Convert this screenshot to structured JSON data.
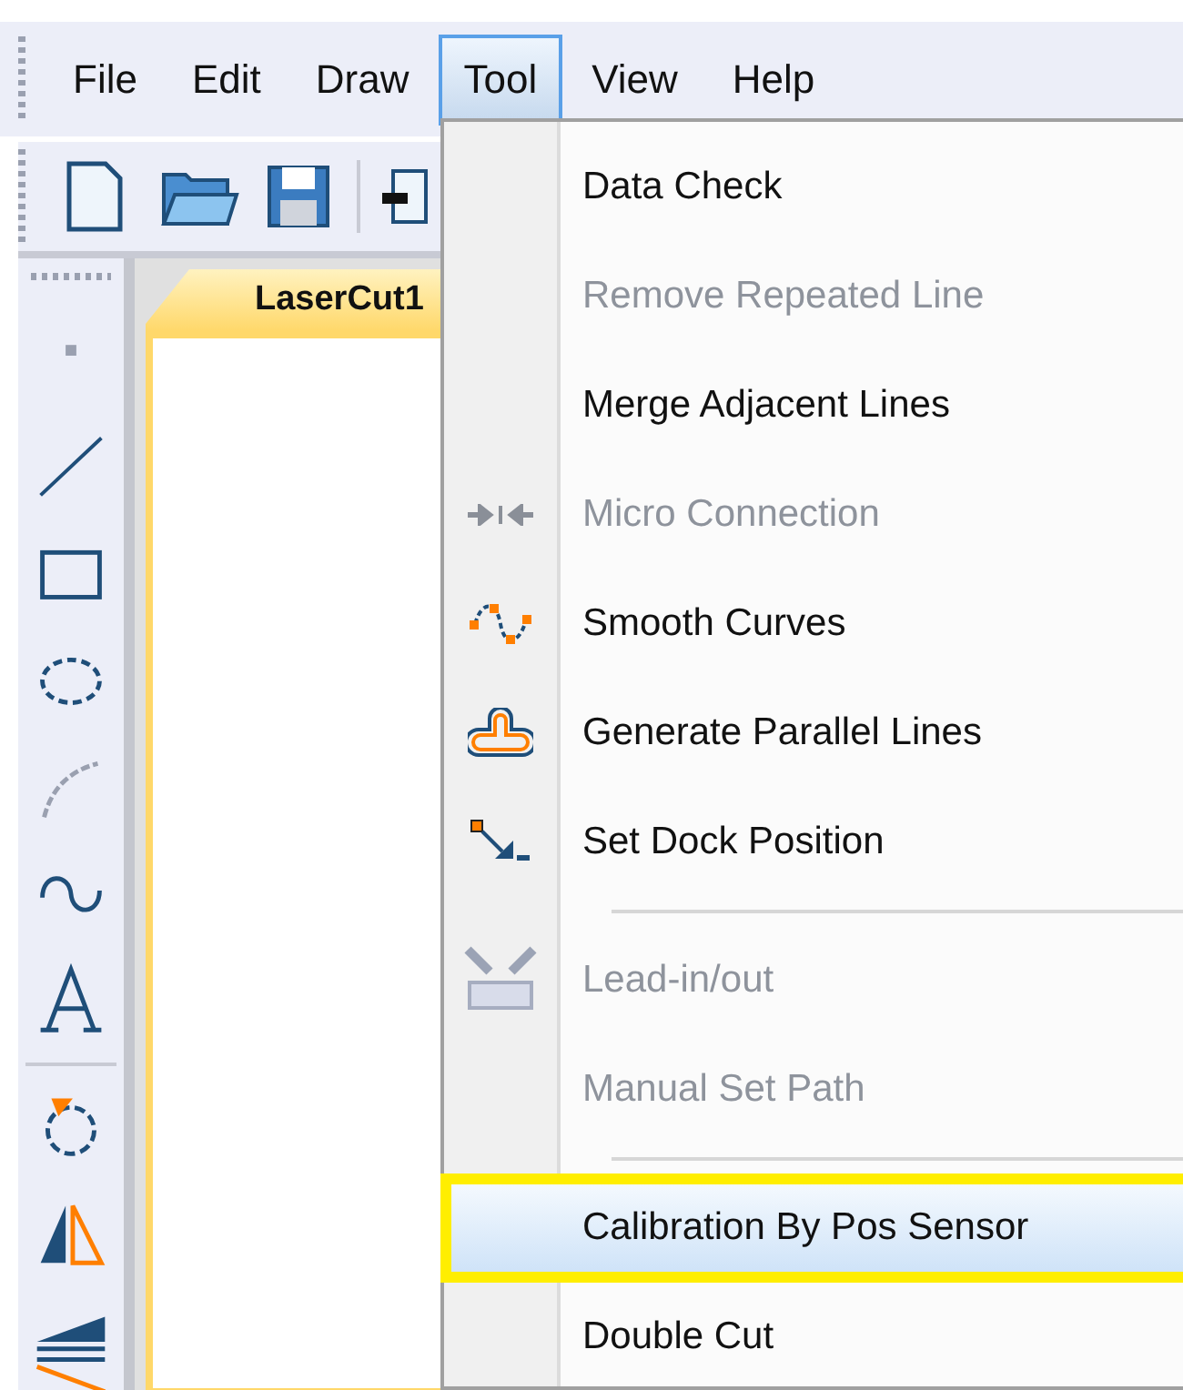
{
  "menu_bar": [
    {
      "label": "File",
      "selected": false
    },
    {
      "label": "Edit",
      "selected": false
    },
    {
      "label": "Draw",
      "selected": false
    },
    {
      "label": "Tool",
      "selected": true
    },
    {
      "label": "View",
      "selected": false
    },
    {
      "label": "Help",
      "selected": false
    }
  ],
  "document_tab": {
    "label": "LaserCut1"
  },
  "tool_menu": [
    {
      "kind": "item",
      "label": "Data Check",
      "disabled": false,
      "selected": false
    },
    {
      "kind": "item",
      "label": "Remove Repeated Line",
      "disabled": true,
      "selected": false
    },
    {
      "kind": "item",
      "label": "Merge Adjacent Lines",
      "disabled": false,
      "selected": false
    },
    {
      "kind": "item",
      "label": "Micro Connection",
      "disabled": true,
      "selected": false
    },
    {
      "kind": "item",
      "label": "Smooth Curves",
      "disabled": false,
      "selected": false
    },
    {
      "kind": "item",
      "label": "Generate Parallel Lines",
      "disabled": false,
      "selected": false
    },
    {
      "kind": "item",
      "label": "Set Dock Position",
      "disabled": false,
      "selected": false
    },
    {
      "kind": "separator"
    },
    {
      "kind": "item",
      "label": "Lead-in/out",
      "disabled": true,
      "selected": false
    },
    {
      "kind": "item",
      "label": "Manual Set Path",
      "disabled": true,
      "selected": false
    },
    {
      "kind": "separator"
    },
    {
      "kind": "item",
      "label": "Calibration By Pos Sensor",
      "disabled": false,
      "selected": true
    },
    {
      "kind": "item",
      "label": "Double Cut",
      "disabled": false,
      "selected": false
    }
  ]
}
